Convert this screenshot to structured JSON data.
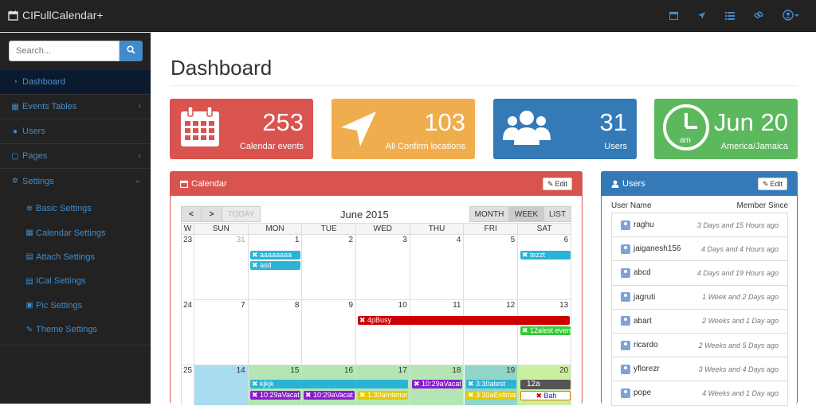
{
  "brand": {
    "name": "CIFullCalendar+",
    "icon": "calendar-icon"
  },
  "topnav": {
    "icons": [
      "calendar-icon",
      "location-arrow-icon",
      "list-icon",
      "link-icon",
      "user-circle-icon"
    ]
  },
  "search": {
    "placeholder": "Search..."
  },
  "sidebar": {
    "items": [
      {
        "label": "Dashboard",
        "icon": "dashboard-icon"
      },
      {
        "label": "Events Tables",
        "icon": "table-icon"
      },
      {
        "label": "Users",
        "icon": "users-icon"
      },
      {
        "label": "Pages",
        "icon": "file-icon"
      },
      {
        "label": "Settings",
        "icon": "cogs-icon"
      }
    ],
    "sub": [
      {
        "label": "Basic Settings",
        "icon": "cog-icon"
      },
      {
        "label": "Calendar Settings",
        "icon": "calendar-icon"
      },
      {
        "label": "Attach Settings",
        "icon": "attach-icon"
      },
      {
        "label": "ICal Settings",
        "icon": "ical-icon"
      },
      {
        "label": "Pic Settings",
        "icon": "picture-icon"
      },
      {
        "label": "Theme Settings",
        "icon": "brush-icon"
      }
    ]
  },
  "page": {
    "title": "Dashboard"
  },
  "stats": [
    {
      "value": "253",
      "label": "Calendar events",
      "color": "#d9534f",
      "icon": "calendar-icon"
    },
    {
      "value": "103",
      "label": "All Confirm locations",
      "color": "#f0ad4e",
      "icon": "location-arrow-icon"
    },
    {
      "value": "31",
      "label": "Users",
      "color": "#337ab7",
      "icon": "users-icon"
    },
    {
      "value": "Jun 20",
      "label": "America/Jamaica",
      "color": "#5cb85c",
      "icon": "clock-icon",
      "clock_text": "am"
    }
  ],
  "calendar_panel": {
    "title": "Calendar",
    "edit": "Edit"
  },
  "calendar": {
    "month": "June 2015",
    "buttons": {
      "prev": "<",
      "next": ">",
      "today": "TODAY",
      "month": "MONTH",
      "week": "WEEK",
      "list": "LIST"
    },
    "dow": [
      "W",
      "SUN",
      "MON",
      "TUE",
      "WED",
      "THU",
      "FRI",
      "SAT"
    ],
    "weeks": [
      {
        "wk": "23",
        "days": [
          "31",
          "1",
          "2",
          "3",
          "4",
          "5",
          "6"
        ]
      },
      {
        "wk": "24",
        "days": [
          "7",
          "8",
          "9",
          "10",
          "11",
          "12",
          "13"
        ]
      },
      {
        "wk": "25",
        "days": [
          "14",
          "15",
          "16",
          "17",
          "18",
          "19",
          "20"
        ]
      }
    ],
    "events": [
      {
        "text": "aaaaaaaa",
        "color": "#2bb3d6"
      },
      {
        "text": "asd",
        "color": "#2bb3d6"
      },
      {
        "text": "tezzt",
        "color": "#2bb3d6"
      },
      {
        "text": "4pBusy",
        "color": "#cc0000"
      },
      {
        "text": "12alest even",
        "color": "#33cc33"
      },
      {
        "text": "kjkjk",
        "color": "#2bb3d6"
      },
      {
        "text": "10:29aVacat",
        "color": "#8a1ccf"
      },
      {
        "text": "10:29aVacat",
        "color": "#8a1ccf"
      },
      {
        "text": "1:30aInterior",
        "color": "#e6c800"
      },
      {
        "text": "10:29aVacat",
        "color": "#8a1ccf"
      },
      {
        "text": "3:30atest",
        "color": "#2bb3d6"
      },
      {
        "text": "3:30aEstimat",
        "color": "#e6c800"
      },
      {
        "text": "12a",
        "color": "#555555"
      },
      {
        "text": "Bah",
        "color": "#ffffff"
      }
    ]
  },
  "users_panel": {
    "title": "Users",
    "edit": "Edit",
    "col_user": "User Name",
    "col_since": "Member Since",
    "rows": [
      {
        "name": "raghu",
        "since": "3 Days and 15 Hours ago"
      },
      {
        "name": "jaiganesh156",
        "since": "4 Days and 4 Hours ago"
      },
      {
        "name": "abcd",
        "since": "4 Days and 19 Hours ago"
      },
      {
        "name": "jagruti",
        "since": "1 Week and 2 Days ago"
      },
      {
        "name": "abart",
        "since": "2 Weeks and 1 Day ago"
      },
      {
        "name": "ricardo",
        "since": "2 Weeks and 5 Days ago"
      },
      {
        "name": "yflorezr",
        "since": "3 Weeks and 4 Days ago"
      },
      {
        "name": "pope",
        "since": "4 Weeks and 1 Day ago"
      }
    ]
  }
}
